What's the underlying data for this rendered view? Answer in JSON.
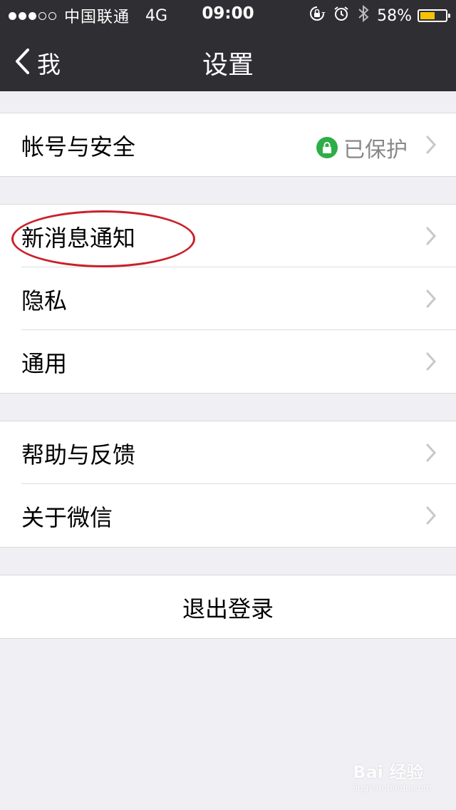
{
  "status_bar": {
    "carrier": "中国联通",
    "network": "4G",
    "time": "09:00",
    "battery_percent": "58%",
    "battery_level": 0.58,
    "battery_color": "#f5c300",
    "icons": [
      "rotation-lock-icon",
      "alarm-icon",
      "bluetooth-icon"
    ]
  },
  "nav": {
    "back_label": "我",
    "title": "设置"
  },
  "groups": {
    "account": {
      "label": "帐号与安全",
      "status": "已保护",
      "status_icon_color": "#2dae47"
    },
    "notifications": {
      "label": "新消息通知"
    },
    "privacy": {
      "label": "隐私"
    },
    "general": {
      "label": "通用"
    },
    "help": {
      "label": "帮助与反馈"
    },
    "about": {
      "label": "关于微信"
    },
    "logout": {
      "label": "退出登录"
    }
  },
  "watermark": {
    "brand": "Bai 经验",
    "url": "jingyan.baidu.com"
  },
  "colors": {
    "header_bg": "#2f2f33",
    "page_bg": "#efeff4",
    "annotation": "#c9202a"
  }
}
